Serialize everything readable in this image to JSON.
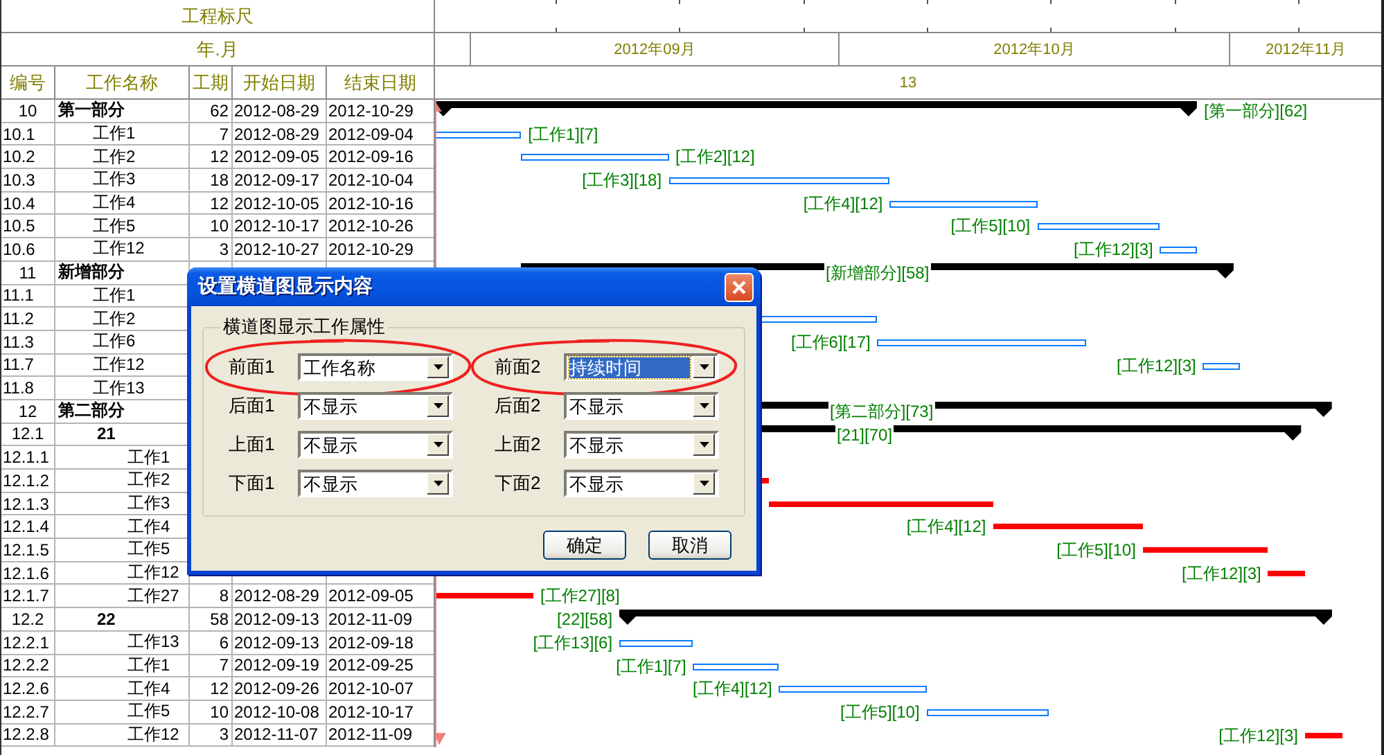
{
  "ruler": {
    "title": "工程标尺",
    "subtitle": "年.月",
    "months": [
      "2012年09月",
      "2012年10月",
      "2012年11月"
    ],
    "period": "13"
  },
  "table": {
    "columns": [
      "编号",
      "工作名称",
      "工期",
      "开始日期",
      "结束日期"
    ],
    "rows": [
      {
        "number": "10",
        "name": "第一部分",
        "kind": "summary",
        "duration": "62",
        "start": "2012-08-29",
        "end": "2012-10-29",
        "bar": {
          "kind": "summary",
          "label": "[第一部分][62]"
        },
        "children": [
          {
            "number": "10.1",
            "name": "工作1",
            "kind": "task",
            "duration": "7",
            "start": "2012-08-29",
            "end": "2012-09-04",
            "bar": {
              "kind": "normal",
              "label": "[工作1][7]"
            }
          },
          {
            "number": "10.2",
            "name": "工作2",
            "kind": "task",
            "duration": "12",
            "start": "2012-09-05",
            "end": "2012-09-16",
            "bar": {
              "kind": "normal",
              "label": "[工作2][12]"
            }
          },
          {
            "number": "10.3",
            "name": "工作3",
            "kind": "task",
            "duration": "18",
            "start": "2012-09-17",
            "end": "2012-10-04",
            "bar": {
              "kind": "normal",
              "label": "[工作3][18]"
            }
          },
          {
            "number": "10.4",
            "name": "工作4",
            "kind": "task",
            "duration": "12",
            "start": "2012-10-05",
            "end": "2012-10-16",
            "bar": {
              "kind": "normal",
              "label": "[工作4][12]"
            }
          },
          {
            "number": "10.5",
            "name": "工作5",
            "kind": "task",
            "duration": "10",
            "start": "2012-10-17",
            "end": "2012-10-26",
            "bar": {
              "kind": "normal",
              "label": "[工作5][10]"
            }
          },
          {
            "number": "10.6",
            "name": "工作12",
            "kind": "task",
            "duration": "3",
            "start": "2012-10-27",
            "end": "2012-10-29",
            "bar": {
              "kind": "normal",
              "label": "[工作12][3]"
            }
          }
        ]
      },
      {
        "number": "11",
        "name": "新增部分",
        "kind": "summary",
        "bar": {
          "kind": "summary",
          "label": "[新增部分][58]"
        },
        "children": [
          {
            "number": "11.1",
            "name": "工作1",
            "kind": "task"
          },
          {
            "number": "11.2",
            "name": "工作2",
            "kind": "task",
            "bar": {
              "kind": "normal"
            }
          },
          {
            "number": "11.3",
            "name": "工作6",
            "kind": "task",
            "bar": {
              "kind": "normal",
              "label": "[工作6][17]"
            }
          },
          {
            "number": "11.7",
            "name": "工作12",
            "kind": "task",
            "bar": {
              "kind": "normal",
              "label": "[工作12][3]"
            }
          },
          {
            "number": "11.8",
            "name": "工作13",
            "kind": "task"
          }
        ]
      },
      {
        "number": "12",
        "name": "第二部分",
        "kind": "summary",
        "bar": {
          "kind": "summary",
          "label": "[第二部分][73]"
        },
        "children": [
          {
            "number": "12.1",
            "name": "21",
            "kind": "summary",
            "bar": {
              "kind": "summary",
              "label": "[21][70]"
            },
            "children": [
              {
                "number": "12.1.1",
                "name": "工作1",
                "kind": "task"
              },
              {
                "number": "12.1.2",
                "name": "工作2",
                "kind": "task",
                "bar": {
                  "kind": "critical"
                }
              },
              {
                "number": "12.1.3",
                "name": "工作3",
                "kind": "task",
                "bar": {
                  "kind": "critical"
                }
              },
              {
                "number": "12.1.4",
                "name": "工作4",
                "kind": "task",
                "bar": {
                  "kind": "critical",
                  "label": "[工作4][12]"
                }
              },
              {
                "number": "12.1.5",
                "name": "工作5",
                "kind": "task",
                "bar": {
                  "kind": "critical",
                  "label": "[工作5][10]"
                }
              },
              {
                "number": "12.1.6",
                "name": "工作12",
                "kind": "task",
                "bar": {
                  "kind": "critical",
                  "label": "[工作12][3]"
                }
              },
              {
                "number": "12.1.7",
                "name": "工作27",
                "kind": "task",
                "duration": "8",
                "start": "2012-08-29",
                "end": "2012-09-05",
                "bar": {
                  "kind": "critical",
                  "label": "[工作27][8]"
                }
              }
            ]
          },
          {
            "number": "12.2",
            "name": "22",
            "kind": "summary",
            "duration": "58",
            "start": "2012-09-13",
            "end": "2012-11-09",
            "bar": {
              "kind": "summary",
              "label": "[22][58]"
            },
            "children": [
              {
                "number": "12.2.1",
                "name": "工作13",
                "kind": "task",
                "duration": "6",
                "start": "2012-09-13",
                "end": "2012-09-18",
                "bar": {
                  "kind": "normal",
                  "label": "[工作13][6]"
                }
              },
              {
                "number": "12.2.2",
                "name": "工作1",
                "kind": "task",
                "duration": "7",
                "start": "2012-09-19",
                "end": "2012-09-25",
                "bar": {
                  "kind": "normal",
                  "label": "[工作1][7]"
                }
              },
              {
                "number": "12.2.6",
                "name": "工作4",
                "kind": "task",
                "duration": "12",
                "start": "2012-09-26",
                "end": "2012-10-07",
                "bar": {
                  "kind": "normal",
                  "label": "[工作4][12]"
                }
              },
              {
                "number": "12.2.7",
                "name": "工作5",
                "kind": "task",
                "duration": "10",
                "start": "2012-10-08",
                "end": "2012-10-17",
                "bar": {
                  "kind": "normal",
                  "label": "[工作5][10]"
                }
              },
              {
                "number": "12.2.8",
                "name": "工作12",
                "kind": "task",
                "duration": "3",
                "start": "2012-11-07",
                "end": "2012-11-09",
                "bar": {
                  "kind": "critical",
                  "label": "[工作12][3]"
                }
              }
            ]
          }
        ]
      }
    ]
  },
  "dialog": {
    "title": "设置横道图显示内容",
    "group": "横道图显示工作属性",
    "fields": [
      {
        "label": "前面1",
        "value": "工作名称",
        "focused": false,
        "circled": true
      },
      {
        "label": "前面2",
        "value": "持续时间",
        "focused": true,
        "circled": true
      },
      {
        "label": "后面1",
        "value": "不显示",
        "focused": false,
        "circled": false
      },
      {
        "label": "后面2",
        "value": "不显示",
        "focused": false,
        "circled": false
      },
      {
        "label": "上面1",
        "value": "不显示",
        "focused": false,
        "circled": false
      },
      {
        "label": "上面2",
        "value": "不显示",
        "focused": false,
        "circled": false
      },
      {
        "label": "下面1",
        "value": "不显示",
        "focused": false,
        "circled": false
      },
      {
        "label": "下面2",
        "value": "不显示",
        "focused": false,
        "circled": false
      }
    ],
    "buttons": [
      "确定",
      "取消"
    ]
  }
}
